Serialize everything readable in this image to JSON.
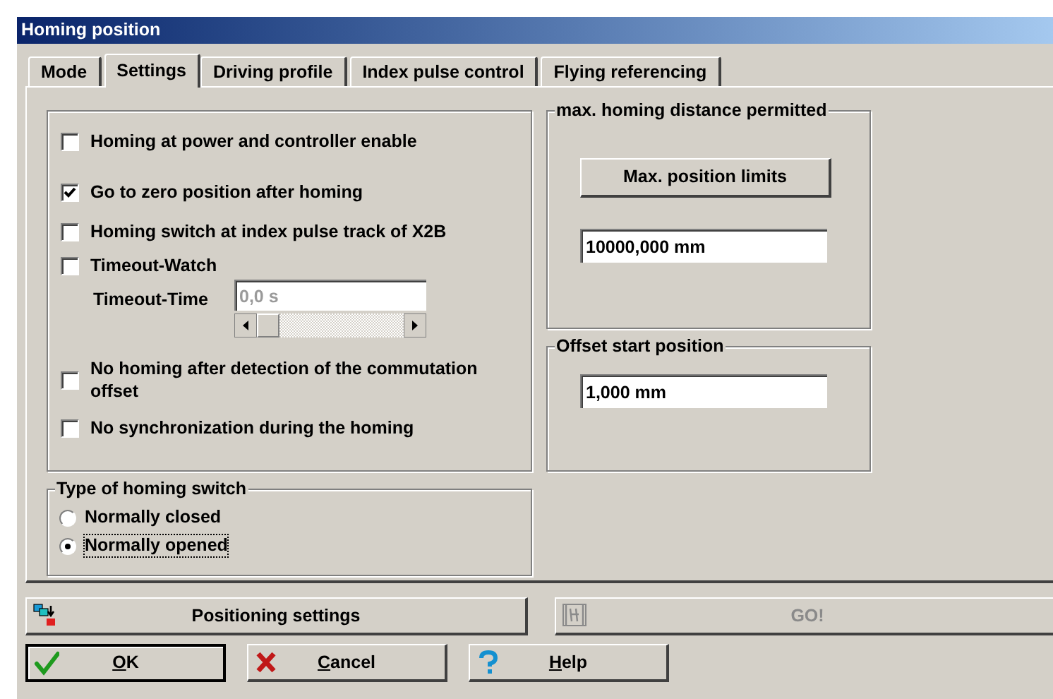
{
  "window": {
    "title": "Homing position"
  },
  "tabs": [
    {
      "label": "Mode",
      "selected": false
    },
    {
      "label": "Settings",
      "selected": true
    },
    {
      "label": "Driving profile",
      "selected": false
    },
    {
      "label": "Index pulse control",
      "selected": false
    },
    {
      "label": "Flying referencing",
      "selected": false
    }
  ],
  "options": [
    {
      "label": "Homing at power and controller enable",
      "checked": false
    },
    {
      "label": "Go to zero position after homing",
      "checked": true
    },
    {
      "label": "Homing switch at index pulse track of X2B",
      "checked": false
    },
    {
      "label": "Timeout-Watch",
      "checked": false,
      "timeout": {
        "label": "Timeout-Time",
        "value": "0,0 s",
        "disabled": true
      }
    },
    {
      "label": "No homing after detection of the commutation offset",
      "checked": false
    },
    {
      "label": "No synchronization during the homing",
      "checked": false
    }
  ],
  "homing_switch": {
    "title": "Type of homing switch",
    "options": [
      {
        "label": "Normally closed",
        "selected": false
      },
      {
        "label": "Normally opened",
        "selected": true
      }
    ]
  },
  "max_distance": {
    "title": "max. homing distance permitted",
    "button": "Max. position limits",
    "value": "10000,000 mm"
  },
  "offset": {
    "title": "Offset start position",
    "value": "1,000 mm"
  },
  "actions": [
    {
      "kind": "positioning",
      "label": "Positioning settings",
      "disabled": false
    },
    {
      "kind": "go",
      "label": "GO!",
      "disabled": true
    }
  ],
  "buttons": [
    {
      "kind": "ok",
      "label": "OK",
      "first_letter_underlined": true,
      "default": true
    },
    {
      "kind": "cancel",
      "label": "Cancel",
      "first_letter_underlined": true,
      "default": false
    },
    {
      "kind": "help",
      "label": "Help",
      "first_letter_underlined": true,
      "default": false
    }
  ]
}
